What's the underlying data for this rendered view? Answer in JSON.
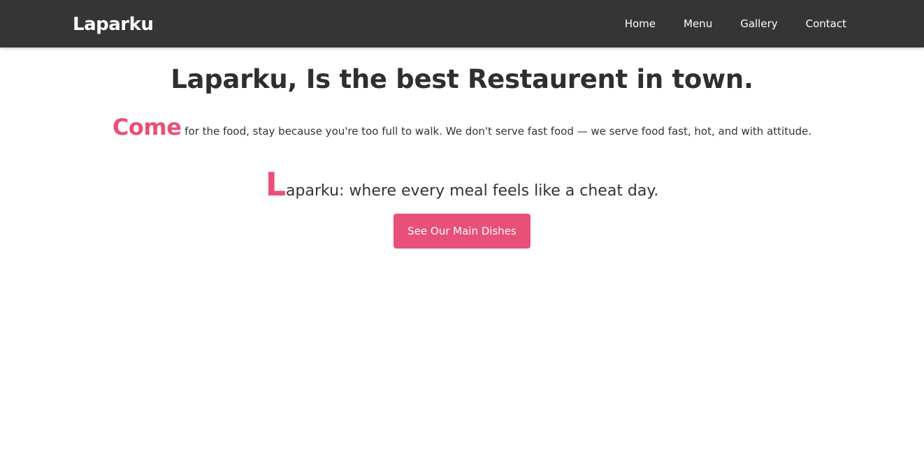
{
  "nav": {
    "brand": "Laparku",
    "links": [
      "Home",
      "Menu",
      "Gallery",
      "Contact"
    ]
  },
  "hero": {
    "title": "Laparku, Is the best Restaurent in town.",
    "tagline_accent": "Come",
    "tagline_rest": " for the food, stay because you're too full to walk. We don't serve fast food — we serve food fast, hot, and with attitude.",
    "slogan_initial": "L",
    "slogan_rest": "aparku: where every meal feels like a cheat day.",
    "cta_label": "See Our Main Dishes"
  },
  "colors": {
    "navbar_bg": "#353535",
    "accent": "#e8507a",
    "text": "#2f2f2f",
    "background": "#ffffff"
  }
}
